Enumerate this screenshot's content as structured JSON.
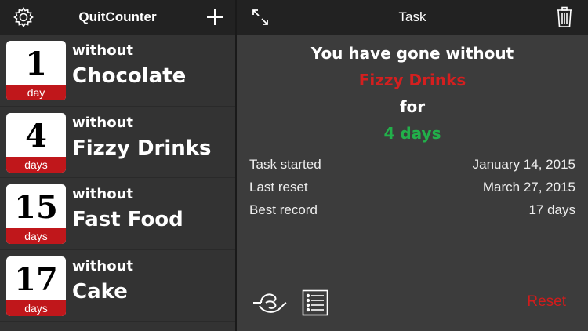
{
  "left_header": {
    "title": "QuitCounter",
    "settings_icon": "gear-icon",
    "add_icon": "plus-icon"
  },
  "list": [
    {
      "count": "1",
      "unit": "day",
      "prefix": "without",
      "item": "Chocolate"
    },
    {
      "count": "4",
      "unit": "days",
      "prefix": "without",
      "item": "Fizzy Drinks"
    },
    {
      "count": "15",
      "unit": "days",
      "prefix": "without",
      "item": "Fast Food"
    },
    {
      "count": "17",
      "unit": "days",
      "prefix": "without",
      "item": "Cake"
    }
  ],
  "right_header": {
    "title": "Task",
    "expand_icon": "expand-icon",
    "delete_icon": "trash-icon"
  },
  "summary": {
    "line1": "You have gone without",
    "item": "Fizzy Drinks",
    "line3": "for",
    "duration": "4 days"
  },
  "details": [
    {
      "label": "Task started",
      "value": "January 14, 2015"
    },
    {
      "label": "Last reset",
      "value": "March 27, 2015"
    },
    {
      "label": "Best record",
      "value": "17 days"
    }
  ],
  "toolbar": {
    "reset_label": "Reset",
    "icons": [
      "hand-icon",
      "list-icon"
    ]
  },
  "colors": {
    "accent_red": "#d01c1c",
    "accent_green": "#22b04a",
    "badge_red": "#c0171b"
  }
}
